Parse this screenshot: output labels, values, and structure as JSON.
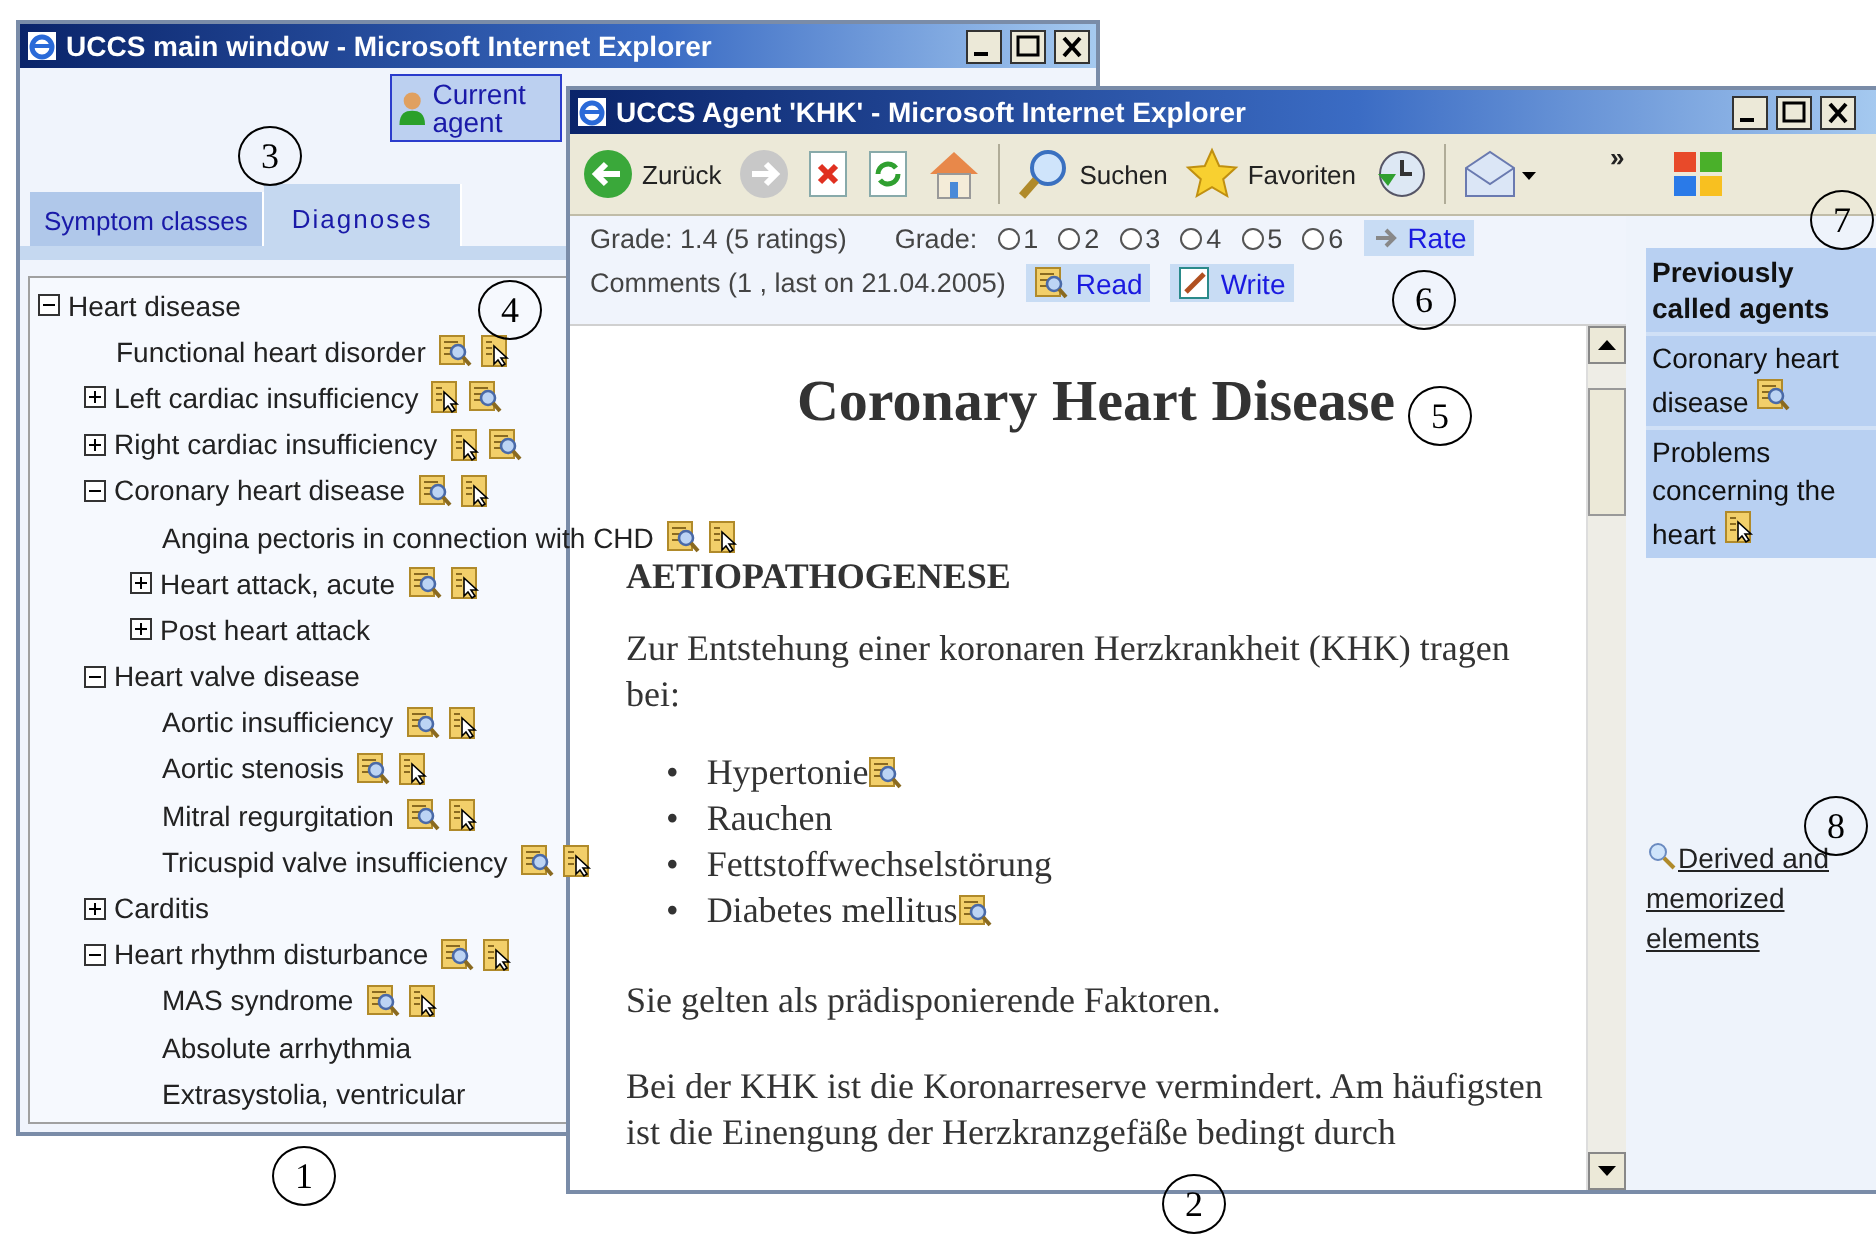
{
  "main_window": {
    "title": "UCCS main window - Microsoft Internet Explorer",
    "agent_button": "Current agent",
    "tabs": [
      {
        "label": "Symptom classes",
        "selected": false
      },
      {
        "label": "Diagnoses",
        "selected": true
      }
    ],
    "tree": [
      {
        "label": "Heart disease",
        "expanded": true,
        "children": [
          {
            "label": "Functional heart disorder",
            "icons": [
              {
                "kind": "magnifier"
              },
              {
                "kind": "pointer"
              }
            ]
          },
          {
            "label": "Left cardiac insufficiency",
            "expanded": false,
            "icons": [
              {
                "kind": "pointer"
              },
              {
                "kind": "magnifier"
              }
            ]
          },
          {
            "label": "Right cardiac insufficiency",
            "expanded": false,
            "icons": [
              {
                "kind": "pointer"
              },
              {
                "kind": "magnifier"
              }
            ]
          },
          {
            "label": "Coronary heart disease",
            "expanded": true,
            "icons": [
              {
                "kind": "magnifier"
              },
              {
                "kind": "pointer"
              }
            ],
            "children": [
              {
                "label": "Angina pectoris in connection with CHD",
                "icons": [
                  {
                    "kind": "magnifier"
                  },
                  {
                    "kind": "pointer"
                  }
                ]
              },
              {
                "label": "Heart attack, acute",
                "expanded": false,
                "icons": [
                  {
                    "kind": "magnifier"
                  },
                  {
                    "kind": "pointer"
                  }
                ]
              },
              {
                "label": "Post heart attack",
                "expanded": false
              }
            ]
          },
          {
            "label": "Heart valve disease",
            "expanded": true,
            "children": [
              {
                "label": "Aortic insufficiency",
                "icons": [
                  {
                    "kind": "magnifier"
                  },
                  {
                    "kind": "pointer"
                  }
                ]
              },
              {
                "label": "Aortic stenosis",
                "icons": [
                  {
                    "kind": "magnifier"
                  },
                  {
                    "kind": "pointer"
                  }
                ]
              },
              {
                "label": "Mitral regurgitation",
                "icons": [
                  {
                    "kind": "magnifier"
                  },
                  {
                    "kind": "pointer"
                  }
                ]
              },
              {
                "label": "Tricuspid valve insufficiency",
                "icons": [
                  {
                    "kind": "magnifier"
                  },
                  {
                    "kind": "pointer"
                  }
                ]
              }
            ]
          },
          {
            "label": "Carditis",
            "expanded": false
          },
          {
            "label": "Heart rhythm disturbance",
            "expanded": true,
            "icons": [
              {
                "kind": "magnifier"
              },
              {
                "kind": "pointer"
              }
            ],
            "children": [
              {
                "label": "MAS syndrome",
                "icons": [
                  {
                    "kind": "magnifier"
                  },
                  {
                    "kind": "pointer"
                  }
                ]
              },
              {
                "label": "Absolute arrhythmia"
              },
              {
                "label": "Extrasystolia, ventricular"
              }
            ]
          }
        ]
      }
    ]
  },
  "agent_window": {
    "title": "UCCS Agent 'KHK' - Microsoft Internet Explorer",
    "toolbar": [
      {
        "kind": "back",
        "label": "Zurück"
      },
      {
        "kind": "forward"
      },
      {
        "kind": "stop"
      },
      {
        "kind": "refresh"
      },
      {
        "kind": "home"
      },
      {
        "kind": "search",
        "label": "Suchen"
      },
      {
        "kind": "favorites",
        "label": "Favoriten"
      },
      {
        "kind": "history"
      },
      {
        "kind": "mail"
      }
    ],
    "more": "»",
    "rating": {
      "summary": "Grade: 1.4 (5 ratings)",
      "label": "Grade:",
      "button": "Rate",
      "options": [
        {
          "label": "1",
          "selected": false
        },
        {
          "label": "2",
          "selected": false
        },
        {
          "label": "3",
          "selected": false
        },
        {
          "label": "4",
          "selected": false
        },
        {
          "label": "5",
          "selected": false
        },
        {
          "label": "6",
          "selected": false
        }
      ]
    },
    "comments": {
      "summary": "Comments (1 , last on 21.04.2005)",
      "read": "Read",
      "write": "Write"
    },
    "article": {
      "heading": "Coronary Heart Disease",
      "section": "AETIOPATHOGENESE",
      "intro": "Zur Entstehung einer koronaren Herzkrankheit (KHK) tragen bei:",
      "list": [
        {
          "bullet": "•",
          "text": "Hypertonie",
          "icons": [
            {
              "kind": "magnifier"
            }
          ]
        },
        {
          "bullet": "•",
          "text": "Rauchen"
        },
        {
          "bullet": "•",
          "text": "Fettstoffwechselstörung"
        },
        {
          "bullet": "•",
          "text": "Diabetes mellitus",
          "icons": [
            {
              "kind": "magnifier"
            }
          ]
        }
      ],
      "paragraphs": [
        "Sie gelten als prädisponierende Faktoren.",
        "Bei der KHK ist die Koronarreserve vermindert. Am häufigsten ist die Einengung der Herzkranzgefäße bedingt durch"
      ]
    },
    "sidebar": {
      "title": "Previously called agents",
      "items": [
        {
          "label": "Coronary heart disease",
          "icons": [
            {
              "kind": "magnifier"
            }
          ]
        },
        {
          "label": "Problems concerning the heart",
          "icons": [
            {
              "kind": "pointer"
            }
          ]
        }
      ],
      "link": "Derived and memorized elements"
    }
  },
  "callouts": [
    "1",
    "2",
    "3",
    "4",
    "5",
    "6",
    "7",
    "8"
  ]
}
